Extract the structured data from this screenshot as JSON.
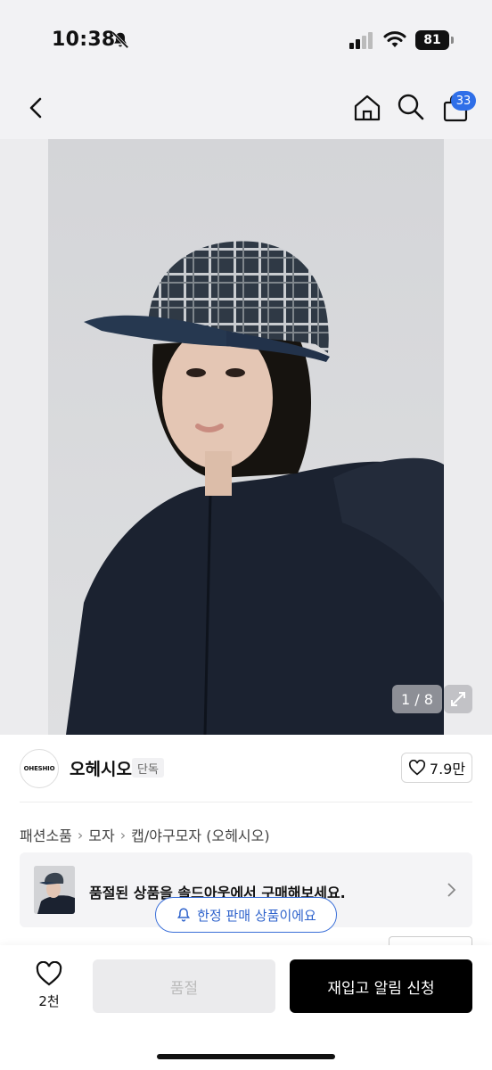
{
  "status_bar": {
    "time": "10:38",
    "battery": "81",
    "icons": [
      "bell-slash-icon",
      "signal-icon",
      "wifi-icon",
      "battery-icon"
    ]
  },
  "nav": {
    "icons": [
      "back-chevron-icon",
      "home-icon",
      "search-icon",
      "cart-icon"
    ],
    "cart_badge": "33"
  },
  "gallery": {
    "counter": "1 / 8",
    "expand_icon": "expand-icon"
  },
  "brand": {
    "logo_text": "OHESHIO",
    "name": "오헤시오",
    "tag": "단독",
    "like_count": "7.9만"
  },
  "breadcrumb": [
    "패션소품",
    "모자",
    "캡/야구모자 (오헤시오)"
  ],
  "soldout_banner": {
    "text": "품절된 상품을 솔드아웃에서 구매해보세요."
  },
  "limited_notice": {
    "text": "한정 판매 상품이에요"
  },
  "bottom_bar": {
    "wish_count": "2천",
    "soldout_label": "품절",
    "restock_label": "재입고 알림 신청"
  },
  "colors": {
    "accent_blue": "#2f6fe8",
    "primary_button": "#000000",
    "disabled_button": "#ebebed"
  }
}
